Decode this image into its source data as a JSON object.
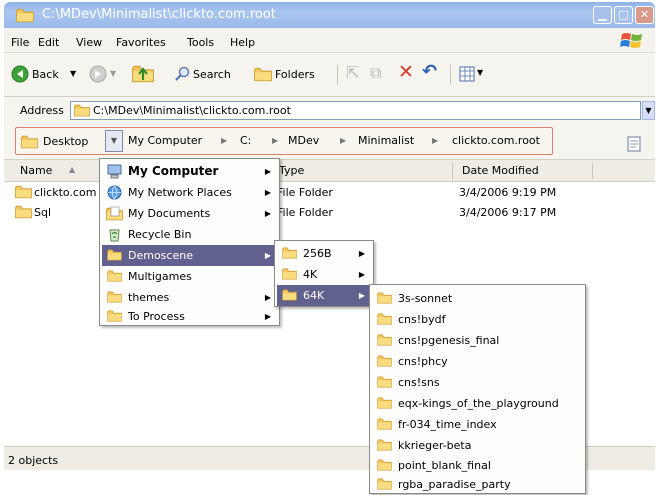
{
  "window": {
    "title": "C:\\MDev\\Minimalist\\clickto.com.root"
  },
  "menubar": [
    "File",
    "Edit",
    "View",
    "Favorites",
    "Tools",
    "Help"
  ],
  "toolbar": {
    "back": "Back",
    "search": "Search",
    "folders": "Folders"
  },
  "address": {
    "label": "Address",
    "value": "C:\\MDev\\Minimalist\\clickto.com.root"
  },
  "breadcrumb": {
    "root": "Desktop",
    "items": [
      "My Computer",
      "C:",
      "MDev",
      "Minimalist",
      "clickto.com.root"
    ]
  },
  "columns": {
    "name": "Name",
    "type": "Type",
    "date": "Date Modified"
  },
  "files": [
    {
      "name": "clickto.com",
      "type": "File Folder",
      "date": "3/4/2006 9:19 PM"
    },
    {
      "name": "Sql",
      "type": "File Folder",
      "date": "3/4/2006 9:17 PM"
    }
  ],
  "status": {
    "text": "2 objects"
  },
  "desktop_menu": [
    {
      "label": "My Computer",
      "icon": "computer-icon",
      "arrow": true,
      "bold": true
    },
    {
      "label": "My Network Places",
      "icon": "network-icon",
      "arrow": true
    },
    {
      "label": "My Documents",
      "icon": "documents-icon",
      "arrow": true
    },
    {
      "label": "Recycle Bin",
      "icon": "recycle-bin-icon",
      "arrow": false
    },
    {
      "label": "Demoscene",
      "icon": "folder-icon",
      "arrow": true,
      "selected": true
    },
    {
      "label": "Multigames",
      "icon": "folder-icon",
      "arrow": false
    },
    {
      "label": "themes",
      "icon": "folder-icon",
      "arrow": true
    },
    {
      "label": "To Process",
      "icon": "folder-icon",
      "arrow": true
    }
  ],
  "demoscene_menu": [
    {
      "label": "256B",
      "arrow": true
    },
    {
      "label": "4K",
      "arrow": true
    },
    {
      "label": "64K",
      "arrow": true,
      "selected": true
    }
  ],
  "k64_menu": [
    "3s-sonnet",
    "cns!bydf",
    "cns!pgenesis_final",
    "cns!phcy",
    "cns!sns",
    "eqx-kings_of_the_playground",
    "fr-034_time_index",
    "kkrieger-beta",
    "point_blank_final",
    "rgba_paradise_party"
  ],
  "colors": {
    "selection": "#616190",
    "folder": "#f3c65a",
    "breadcrumb_border": "#e2806a"
  }
}
